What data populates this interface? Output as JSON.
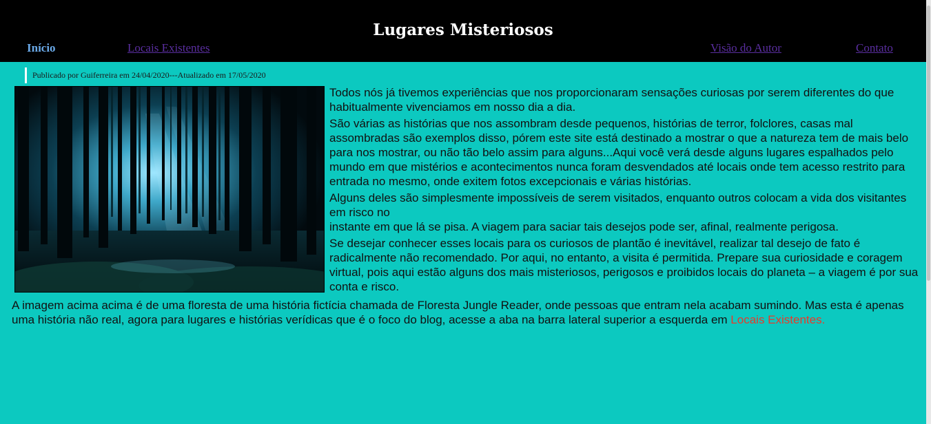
{
  "header": {
    "title": "Lugares Misteriosos",
    "nav": {
      "home": "Início",
      "locais": "Locais Existentes",
      "visao": "Visão do Autor",
      "contato": "Contato"
    }
  },
  "post": {
    "meta": "Publicado por Guiferreira em 24/04/2020---Atualizado em 17/05/2020",
    "image_icon": "forest-image",
    "paragraphs": [
      "Todos nós já tivemos experiências que nos proporcionaram sensações curiosas por serem diferentes do que habitualmente vivenciamos em nosso dia a dia.",
      "São várias as histórias que nos assombram desde pequenos, histórias de terror, folclores, casas mal assombradas são exemplos disso, pórem este site está destinado a mostrar o que a natureza tem de mais belo para nos mostrar, ou não tão belo assim para alguns...Aqui você verá desde alguns lugares espalhados pelo mundo em que mistérios e acontecimentos nunca foram desvendados até locais onde tem acesso restrito para entrada no mesmo, onde exitem fotos excepcionais e várias histórias.",
      "Alguns deles são simplesmente impossíveis de serem visitados, enquanto outros colocam a vida dos visitantes em risco no",
      "instante em que lá se pisa. A viagem para saciar tais desejos pode ser, afinal, realmente perigosa.",
      "Se desejar conhecer esses locais para os curiosos de plantão é inevitável, realizar tal desejo de fato é radicalmente não recomendado. Por aqui, no entanto, a visita é permitida. Prepare sua curiosidade e coragem virtual, pois aqui estão alguns dos mais misteriosos, perigosos e proibidos locais do planeta – a viagem é por sua conta e risco."
    ],
    "footer_text": "A imagem acima acima é de uma floresta de uma história fictícia chamada de Floresta Jungle Reader, onde pessoas que entram nela acabam sumindo. Mas esta é apenas uma história não real, agora para lugares e histórias verídicas que é o foco do blog, acesse a aba na barra lateral superior a esquerda em ",
    "footer_link": "Locais Existentes."
  },
  "colors": {
    "background": "#0cc9c0",
    "header_bg": "#000000",
    "link_visited": "#5a2ea0",
    "link_active": "#6aa9e8",
    "highlight_link": "#e83a2a"
  }
}
